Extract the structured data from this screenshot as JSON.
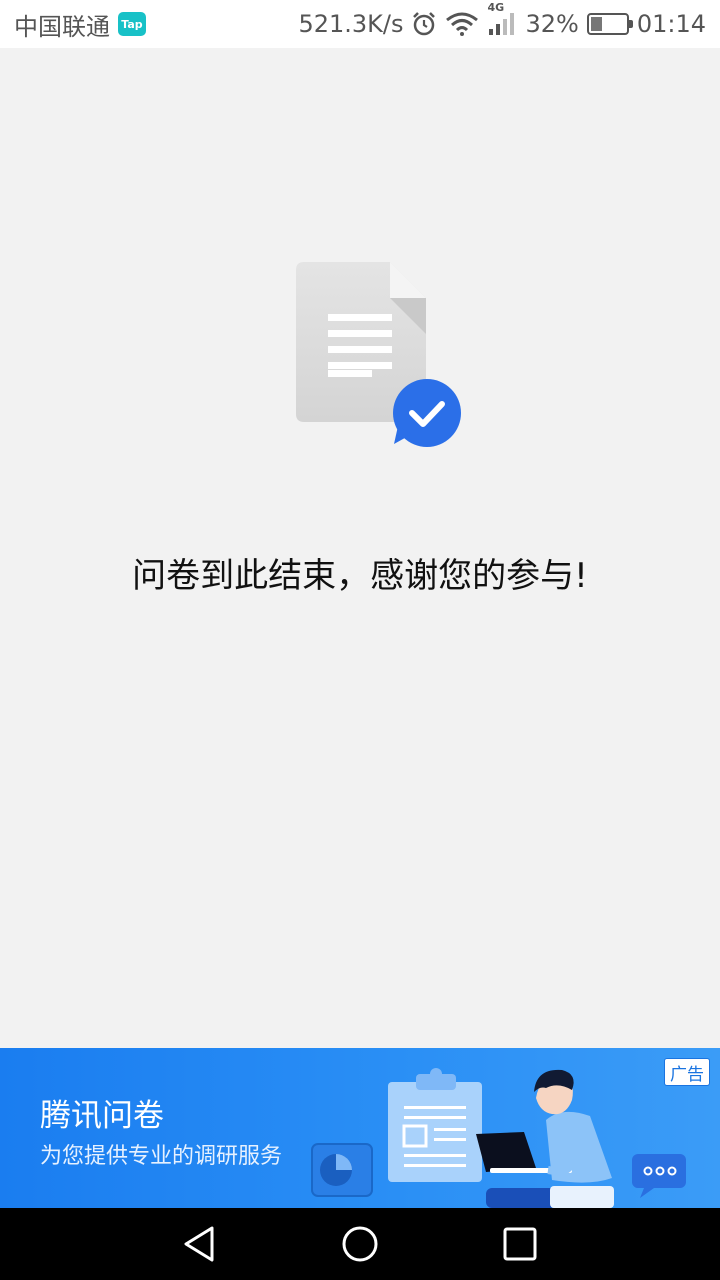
{
  "status_bar": {
    "carrier": "中国联通",
    "app_badge": "Tap",
    "net_speed": "521.3K/s",
    "network_type": "4G",
    "battery_percent": "32%",
    "battery_level": 0.32,
    "time": "01:14",
    "icons": [
      "alarm-icon",
      "wifi-icon",
      "signal-icon",
      "battery-icon"
    ]
  },
  "main": {
    "icon": "document-check-icon",
    "message": "问卷到此结束，感谢您的参与!"
  },
  "ad": {
    "title": "腾讯问卷",
    "subtitle": "为您提供专业的调研服务",
    "badge": "广告"
  },
  "nav_bar": {
    "icons": [
      "back-icon",
      "home-icon",
      "recent-apps-icon"
    ]
  },
  "colors": {
    "accent": "#2b6fe8",
    "banner": "#1a7df0",
    "background": "#f2f2f2"
  }
}
